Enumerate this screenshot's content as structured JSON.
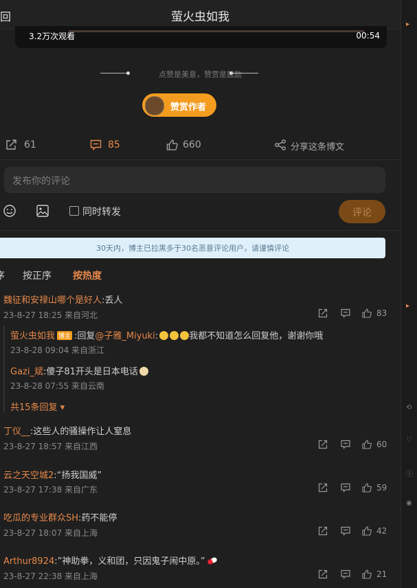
{
  "header": {
    "back_label": "回",
    "title": "萤火虫如我"
  },
  "video": {
    "views": "3.2万次观看",
    "duration": "00:54"
  },
  "reward": {
    "text": "点赞是美意，赞赏是鼓励",
    "button": "赞赏作者"
  },
  "stats": {
    "share_count": "61",
    "comment_count": "85",
    "like_count": "660",
    "share_post": "分享这条博文"
  },
  "composer": {
    "placeholder": "发布你的评论",
    "repost_label": "同时转发",
    "submit_label": "评论"
  },
  "notice": "30天内，博主已拉黑多于30名恶意评论用户，请谨慎评论",
  "sort": {
    "cut_label": "序",
    "by_time": "按正序",
    "by_hot": "按热度"
  },
  "comments": [
    {
      "user": "魏征和安禄山哪个是好人",
      "text": ":丢人",
      "meta": "23-8-27 18:25 来自河北",
      "likes": "83"
    },
    {
      "user": "丁仪__",
      "text": ":这些人的骚操作让人窒息",
      "meta": "23-8-27 18:57 来自江西",
      "likes": "60"
    },
    {
      "user": "云之天空城2",
      "text": ":“扬我国威”",
      "meta": "23-8-27 17:38 来自广东",
      "likes": "59"
    },
    {
      "user": "吃瓜的专业群众SH",
      "text": ":药不能停",
      "meta": "23-8-27 18:07 来自上海",
      "likes": "42"
    },
    {
      "user": "Arthur8924",
      "text": ":”神助拳，义和团，只因鬼子闹中原。”",
      "meta": "23-8-27 22:38 来自上海",
      "likes": "21"
    }
  ],
  "replies": [
    {
      "user": "萤火虫如我",
      "badge": "博主",
      "text_prefix": ":回复",
      "mention": "@子雅_Miyuki",
      "text": ":",
      "text_after": "我都不知道怎么回复他，谢谢你哦",
      "meta": "23-8-28 09:04 来自浙江"
    },
    {
      "user": "Gazi_斌",
      "text": ":傻子81开头是日本电话",
      "meta": "23-8-28 07:55 来自云南"
    }
  ],
  "more_replies": "共15条回复",
  "colors": {
    "accent": "#e7884a",
    "button": "#f39c1f",
    "background": "#1f1f1f"
  }
}
